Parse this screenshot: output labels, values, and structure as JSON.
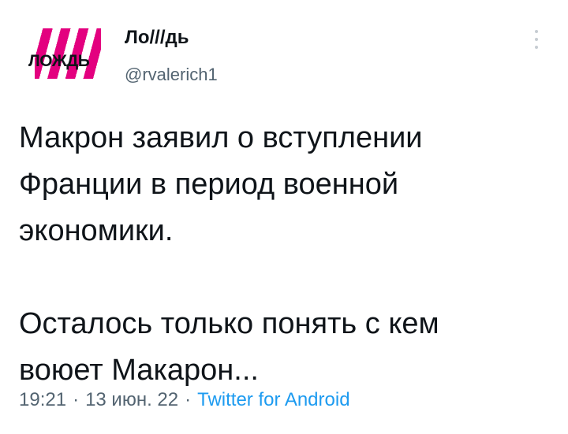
{
  "author": {
    "name": "Ло///дь",
    "handle": "@rvalerich1",
    "avatar_text": "ЛОЖДЬ",
    "avatar_stripe_color": "#e3007f"
  },
  "tweet": {
    "line1": "Макрон заявил о вступлении",
    "line2": "Франции в период военной",
    "line3": "экономики.",
    "line4": "Осталось только понять с кем",
    "line5": "воюет Макарон..."
  },
  "meta": {
    "time": "19:21",
    "separator": "·",
    "date": "13 июн. 22",
    "source": "Twitter for Android"
  },
  "icons": {
    "more": "more-vertical-icon"
  },
  "colors": {
    "text": "#0f1419",
    "secondary": "#536471",
    "link": "#1d9bf0"
  }
}
